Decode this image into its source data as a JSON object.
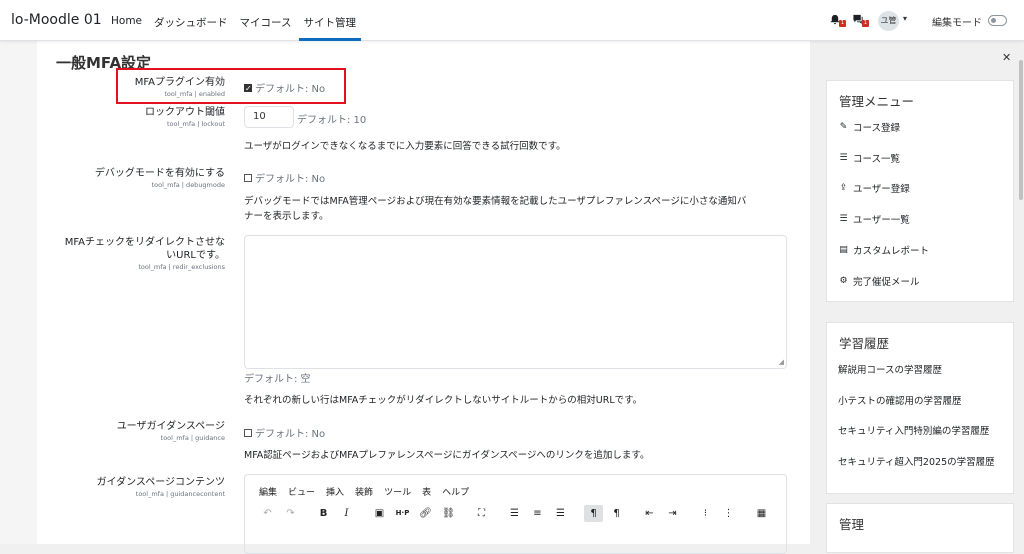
{
  "brand": "lo-Moodle 01",
  "nav": [
    {
      "label": "Home",
      "active": false
    },
    {
      "label": "ダッシュボード",
      "active": false
    },
    {
      "label": "マイコース",
      "active": false
    },
    {
      "label": "サイト管理",
      "active": true
    }
  ],
  "notifications_count": "1",
  "messages_count": "1",
  "avatar_initials": "ユ管",
  "edit_mode_label": "編集モード",
  "section_title": "一般MFA設定",
  "settings": {
    "enabled": {
      "label": "MFAプラグイン有効",
      "sub": "tool_mfa | enabled",
      "default": "デフォルト: No"
    },
    "lockout": {
      "label": "ロックアウト閾値",
      "sub": "tool_mfa | lockout",
      "value": "10",
      "default": "デフォルト: 10",
      "desc": "ユーザがログインできなくなるまでに入力要素に回答できる試行回数です。"
    },
    "debugmode": {
      "label": "デバッグモードを有効にする",
      "sub": "tool_mfa | debugmode",
      "default": "デフォルト: No",
      "desc1": "デバッグモードではMFA管理ページおよび現在有効な要素情報を記載したユーザプレファレンスページに小さな通知バ",
      "desc2": "ナーを表示します。"
    },
    "redir": {
      "label1": "MFAチェックをリダイレクトさせな",
      "label2": "いURLです。",
      "sub": "tool_mfa | redir_exclusions",
      "default": "デフォルト: 空",
      "desc": "それぞれの新しい行はMFAチェックがリダイレクトしないサイトルートからの相対URLです。"
    },
    "guidance": {
      "label": "ユーザガイダンスページ",
      "sub": "tool_mfa | guidance",
      "default": "デフォルト: No",
      "desc": "MFA認証ページおよびMFAプレファレンスページにガイダンスページへのリンクを追加します。"
    },
    "guidancecontent": {
      "label": "ガイダンスページコンテンツ",
      "sub": "tool_mfa | guidancecontent"
    }
  },
  "editor_menu": [
    "編集",
    "ビュー",
    "挿入",
    "装飾",
    "ツール",
    "表",
    "ヘルプ"
  ],
  "admin_menu": {
    "title": "管理メニュー",
    "items": [
      {
        "icon": "edit-icon",
        "label": "コース登録"
      },
      {
        "icon": "list-icon",
        "label": "コース一覧"
      },
      {
        "icon": "upload-icon",
        "label": "ユーザー登録"
      },
      {
        "icon": "list-icon",
        "label": "ユーザー一覧"
      },
      {
        "icon": "file-icon",
        "label": "カスタムレポート"
      },
      {
        "icon": "gear-icon",
        "label": "完了催促メール"
      }
    ]
  },
  "history": {
    "title": "学習履歴",
    "items": [
      "解説用コースの学習履歴",
      "小テストの確認用の学習履歴",
      "セキュリティ入門特別編の学習履歴",
      "セキュリティ超入門2025の学習履歴"
    ]
  },
  "admin_title": "管理",
  "colors": {
    "accent": "#0f6cbf",
    "highlight": "#e3101e",
    "badge": "#ca3120"
  }
}
